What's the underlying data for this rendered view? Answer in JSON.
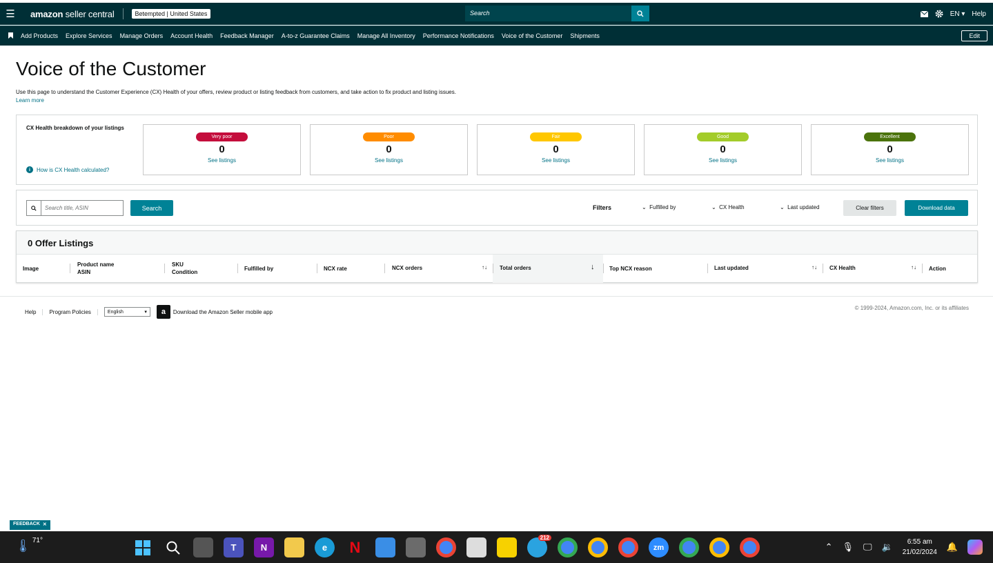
{
  "topbar": {
    "brand_main": "amazon",
    "brand_sub": " seller central",
    "account": "Betempted | United States",
    "search_placeholder": "Search",
    "language": "EN ▾",
    "help": "Help"
  },
  "nav": {
    "items": [
      "Add Products",
      "Explore Services",
      "Manage Orders",
      "Account Health",
      "Feedback Manager",
      "A-to-z Guarantee Claims",
      "Manage All Inventory",
      "Performance Notifications",
      "Voice of the Customer",
      "Shipments"
    ],
    "edit": "Edit"
  },
  "page": {
    "title": "Voice of the Customer",
    "description": "Use this page to understand the Customer Experience (CX) Health of your offers, review product or listing feedback from customers, and take action to fix product and listing issues.",
    "learn_more": "Learn more"
  },
  "cx": {
    "label": "CX Health breakdown of your listings",
    "how": "How is CX Health calculated?",
    "cards": [
      {
        "label": "Very poor",
        "count": "0",
        "link": "See listings",
        "color": "#c40d3c"
      },
      {
        "label": "Poor",
        "count": "0",
        "link": "See listings",
        "color": "#ff8c00"
      },
      {
        "label": "Fair",
        "count": "0",
        "link": "See listings",
        "color": "#ffc700"
      },
      {
        "label": "Good",
        "count": "0",
        "link": "See listings",
        "color": "#a3cc2a"
      },
      {
        "label": "Excellent",
        "count": "0",
        "link": "See listings",
        "color": "#4b730c"
      }
    ]
  },
  "filters": {
    "search_placeholder": "Search title, ASIN",
    "search_button": "Search",
    "label": "Filters",
    "fulfilled_by": "Fulfilled by",
    "cx_health": "CX Health",
    "last_updated": "Last updated",
    "clear": "Clear filters",
    "download": "Download data"
  },
  "listings": {
    "title": "0 Offer Listings",
    "columns": {
      "image": "Image",
      "product_name": "Product name",
      "asin": "ASIN",
      "sku": "SKU",
      "condition": "Condition",
      "fulfilled_by": "Fulfilled by",
      "ncx_rate": "NCX rate",
      "ncx_orders": "NCX orders",
      "total_orders": "Total orders",
      "top_ncx_reason": "Top NCX reason",
      "last_updated": "Last updated",
      "cx_health": "CX Health",
      "action": "Action"
    }
  },
  "footer": {
    "help": "Help",
    "policies": "Program Policies",
    "language": "English",
    "app": "Download the Amazon Seller mobile app",
    "copyright": "© 1999-2024, Amazon.com, Inc. or its affiliates"
  },
  "feedback": "FEEDBACK",
  "taskbar": {
    "temperature": "71°",
    "time": "6:55 am",
    "date": "21/02/2024",
    "telegram_badge": "212"
  }
}
